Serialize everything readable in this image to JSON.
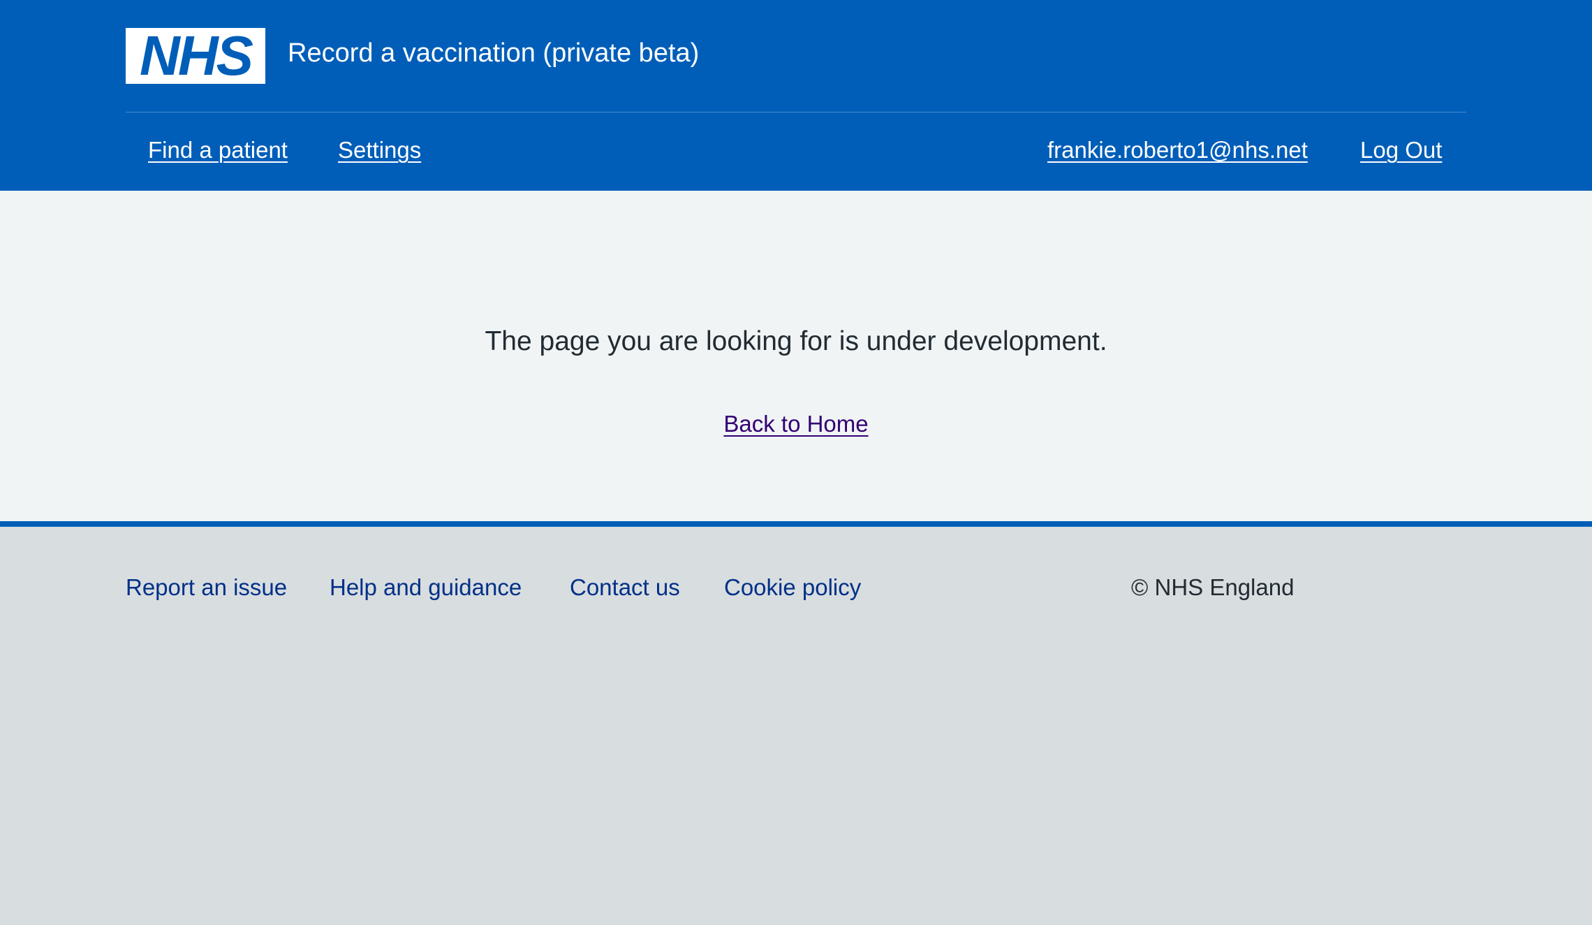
{
  "header": {
    "logo_text": "NHS",
    "service_name": "Record a vaccination (private beta)",
    "nav": {
      "find_patient": "Find a patient",
      "settings": "Settings",
      "user_email": "frankie.roberto1@nhs.net",
      "log_out": "Log Out"
    }
  },
  "main": {
    "message": "The page you are looking for is under development.",
    "back_link": "Back to Home"
  },
  "footer": {
    "links": {
      "report_issue": "Report an issue",
      "help": "Help and guidance",
      "contact": "Contact us",
      "cookie": "Cookie policy"
    },
    "copyright": "© NHS England"
  },
  "colors": {
    "nhs_blue": "#005eb8",
    "main_background": "#f0f4f5",
    "footer_background": "#d8dde0",
    "footer_link": "#003087",
    "visited_link": "#330072",
    "text": "#212b32"
  }
}
